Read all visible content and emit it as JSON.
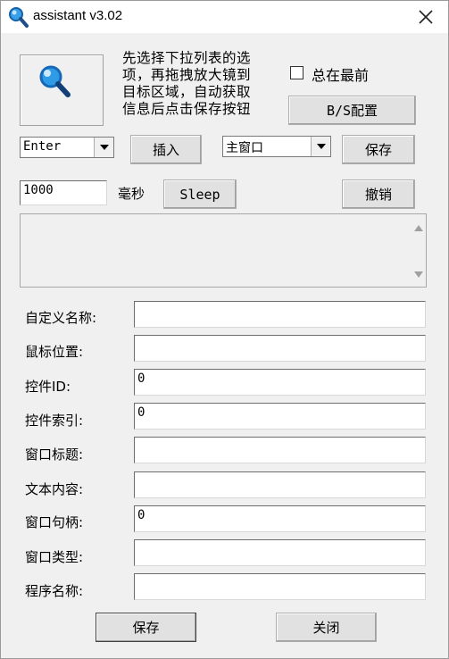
{
  "window": {
    "title": "assistant v3.02",
    "close_glyph": "✕"
  },
  "instructions": [
    "先选择下拉列表的选",
    "项，再拖拽放大镜到",
    "目标区域，自动获取",
    "信息后点击保存按钮"
  ],
  "always_on_top": {
    "label": "总在最前",
    "checked": false
  },
  "bs_config_button": "B/S配置",
  "key_combo": {
    "value": "Enter"
  },
  "insert_button": "插入",
  "window_combo": {
    "value": "主窗口"
  },
  "save_top_button": "保存",
  "delay_input": {
    "value": "1000"
  },
  "delay_unit": "毫秒",
  "sleep_button": "Sleep",
  "undo_button": "撤销",
  "fields": [
    {
      "label": "自定义名称:",
      "value": ""
    },
    {
      "label": "鼠标位置:",
      "value": ""
    },
    {
      "label": "控件ID:",
      "value": "0"
    },
    {
      "label": "控件索引:",
      "value": "0"
    },
    {
      "label": "窗口标题:",
      "value": ""
    },
    {
      "label": "文本内容:",
      "value": ""
    },
    {
      "label": "窗口句柄:",
      "value": "0"
    },
    {
      "label": "窗口类型:",
      "value": ""
    },
    {
      "label": "程序名称:",
      "value": ""
    }
  ],
  "save_bottom_button": "保存",
  "close_button": "关闭",
  "icons": {
    "title": "magnifier-icon",
    "picker": "magnifier-icon"
  },
  "colors": {
    "accent": "#1e8fe0"
  }
}
